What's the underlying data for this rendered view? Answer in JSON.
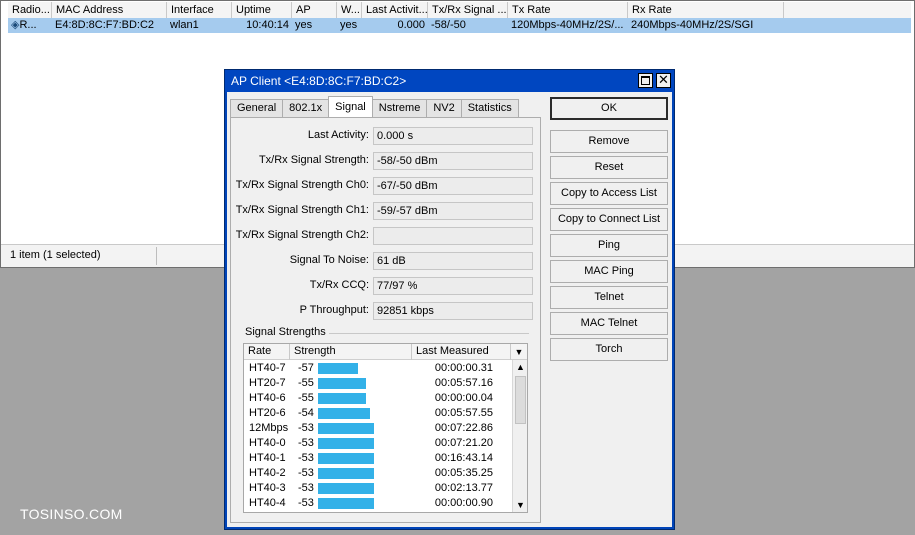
{
  "list": {
    "columns": [
      "Radio...",
      "MAC Address",
      "Interface",
      "Uptime",
      "AP",
      "W...",
      "Last Activit...",
      "Tx/Rx Signal ...",
      "Tx Rate",
      "Rx Rate"
    ],
    "row": {
      "radio": "R...",
      "mac": "E4:8D:8C:F7:BD:C2",
      "interface": "wlan1",
      "uptime": "10:40:14",
      "ap": "yes",
      "w": "yes",
      "last_activity": "0.000",
      "signal": "-58/-50",
      "tx_rate": "120Mbps-40MHz/2S/...",
      "rx_rate": "240Mbps-40MHz/2S/SGI"
    },
    "status": "1 item (1 selected)"
  },
  "dialog": {
    "title": "AP Client <E4:8D:8C:F7:BD:C2>",
    "tabs": [
      "General",
      "802.1x",
      "Signal",
      "Nstreme",
      "NV2",
      "Statistics"
    ],
    "active_tab": "Signal",
    "fields": [
      {
        "label": "Last Activity:",
        "value": "0.000 s"
      },
      {
        "label": "Tx/Rx Signal Strength:",
        "value": "-58/-50 dBm"
      },
      {
        "label": "Tx/Rx Signal Strength Ch0:",
        "value": "-67/-50 dBm"
      },
      {
        "label": "Tx/Rx Signal Strength Ch1:",
        "value": "-59/-57 dBm"
      },
      {
        "label": "Tx/Rx Signal Strength Ch2:",
        "value": ""
      },
      {
        "label": "Signal To Noise:",
        "value": "61 dB"
      },
      {
        "label": "Tx/Rx CCQ:",
        "value": "77/97 %"
      },
      {
        "label": "P Throughput:",
        "value": "92851 kbps"
      }
    ],
    "signal_strengths": {
      "label": "Signal Strengths",
      "columns": [
        "Rate",
        "Strength",
        "Last Measured"
      ],
      "rows": [
        {
          "rate": "HT40-7",
          "strength": "-57",
          "last": "00:00:00.31"
        },
        {
          "rate": "HT20-7",
          "strength": "-55",
          "last": "00:05:57.16"
        },
        {
          "rate": "HT40-6",
          "strength": "-55",
          "last": "00:00:00.04"
        },
        {
          "rate": "HT20-6",
          "strength": "-54",
          "last": "00:05:57.55"
        },
        {
          "rate": "12Mbps",
          "strength": "-53",
          "last": "00:07:22.86"
        },
        {
          "rate": "HT40-0",
          "strength": "-53",
          "last": "00:07:21.20"
        },
        {
          "rate": "HT40-1",
          "strength": "-53",
          "last": "00:16:43.14"
        },
        {
          "rate": "HT40-2",
          "strength": "-53",
          "last": "00:05:35.25"
        },
        {
          "rate": "HT40-3",
          "strength": "-53",
          "last": "00:02:13.77"
        },
        {
          "rate": "HT40-4",
          "strength": "-53",
          "last": "00:00:00.90"
        }
      ]
    },
    "buttons": [
      "OK",
      "Remove",
      "Reset",
      "Copy to Access List",
      "Copy to Connect List",
      "Ping",
      "MAC Ping",
      "Telnet",
      "MAC Telnet",
      "Torch"
    ]
  },
  "watermark": "TOSINSO.COM",
  "colors": {
    "selection": "#a5cbee",
    "titlebar": "#0046c0",
    "strength_bar": "#33b1e8"
  }
}
